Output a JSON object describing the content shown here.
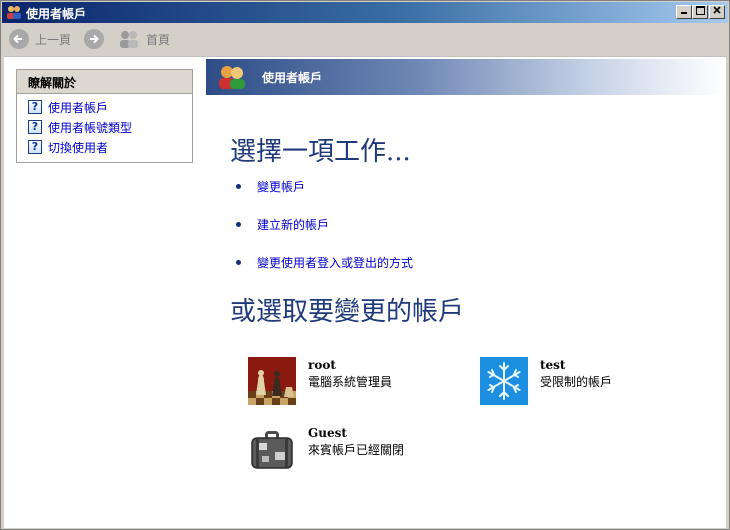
{
  "window": {
    "title": "使用者帳戶"
  },
  "toolbar": {
    "back_label": "上一頁",
    "home_label": "首頁"
  },
  "sidebar": {
    "heading": "瞭解關於",
    "links": [
      {
        "label": "使用者帳戶"
      },
      {
        "label": "使用者帳號類型"
      },
      {
        "label": "切換使用者"
      }
    ]
  },
  "header": {
    "title": "使用者帳戶"
  },
  "main": {
    "task_heading": "選擇一項工作...",
    "tasks": [
      {
        "label": "變更帳戶"
      },
      {
        "label": "建立新的帳戶"
      },
      {
        "label": "變更使用者登入或登出的方式"
      }
    ],
    "account_heading": "或選取要變更的帳戶",
    "accounts": [
      {
        "name": "root",
        "type": "電腦系統管理員",
        "picture": "chess-icon"
      },
      {
        "name": "test",
        "type": "受限制的帳戶",
        "picture": "snowflake-icon"
      },
      {
        "name": "Guest",
        "type": "來賓帳戶已經關閉",
        "picture": "suitcase-icon"
      }
    ]
  },
  "colors": {
    "accent": "#1f3a7a",
    "link": "#0000cc",
    "titlebar": "#0a246a"
  }
}
